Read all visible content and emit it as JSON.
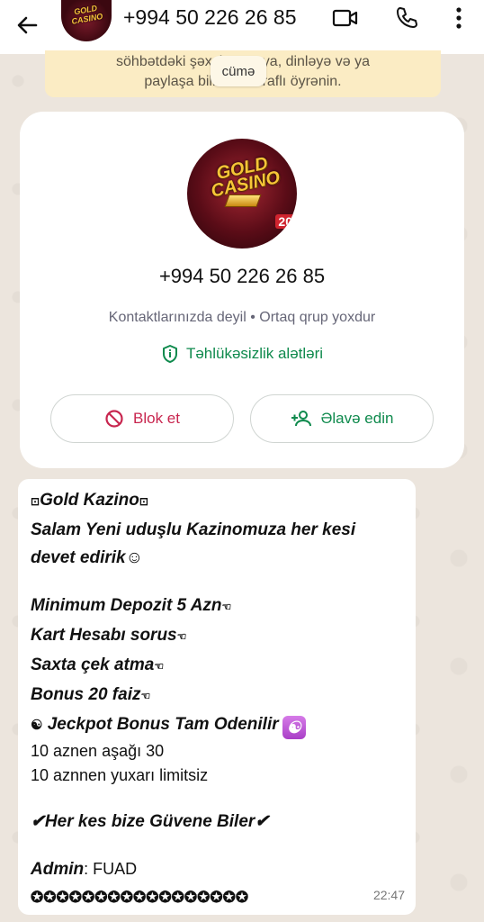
{
  "header": {
    "back_icon": "arrow-left-icon",
    "title": "+994 50 226 26 85",
    "avatar_text": "GOLD CASINO",
    "video_icon": "video-camera-icon",
    "call_icon": "phone-icon",
    "menu_icon": "more-vert-icon"
  },
  "notice": {
    "line1": "söhbətdəki şəxslər oxuya, dinləyə və ya",
    "line2": "paylaşa bilməz. Ətraflı öyrənin.",
    "day_chip": "cümə"
  },
  "contact_card": {
    "avatar_text_1": "GOLD",
    "avatar_text_2": "CASINO",
    "avatar_badge": "20",
    "phone": "+994 50 226 26 85",
    "subtitle": "Kontaktlarınızda deyil • Ortaq qrup yoxdur",
    "security_label": "Təhlükəsizlik alətləri",
    "block_label": "Blok et",
    "add_label": "Əlavə edin"
  },
  "message": {
    "title": "Gold Kazino",
    "line1": "Salam Yeni uduşlu Kazinomuza her kesi",
    "line2": "devet edirik☺",
    "item1": "Minimum Depozit 5 Azn",
    "item2": "Kart Hesabı sorus",
    "item3": "Saxta çek atma",
    "item4": "Bonus 20 faiz",
    "jackpot": "Jeckpot Bonus Tam Odenilir",
    "yin_yang": "☯",
    "plain1": "10 aznen aşağı 30",
    "plain2": "10 aznnen yuxarı limitsiz",
    "trust": "✔Her kes bize Güvene Biler✔",
    "admin_label": "Admin",
    "admin_value": ": FUAD",
    "stars": "✪✪✪✪✪✪✪✪✪✪✪✪✪✪✪✪✪",
    "hand": "☜",
    "bullet": "⊡",
    "time": "22:47"
  },
  "colors": {
    "accent_green": "#0f8a4d",
    "block_red": "#c8264f",
    "notice_bg": "#fbecc4",
    "chat_bg": "#ece5dd"
  }
}
